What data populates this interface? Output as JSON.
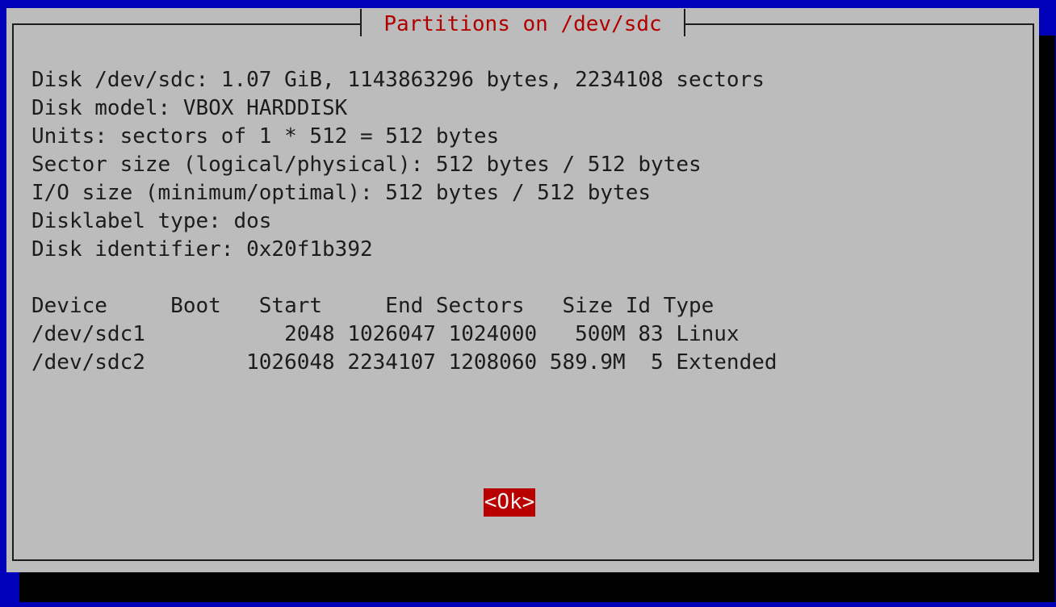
{
  "dialog": {
    "title": "Partitions on /dev/sdc",
    "info_lines": [
      "Disk /dev/sdc: 1.07 GiB, 1143863296 bytes, 2234108 sectors",
      "Disk model: VBOX HARDDISK",
      "Units: sectors of 1 * 512 = 512 bytes",
      "Sector size (logical/physical): 512 bytes / 512 bytes",
      "I/O size (minimum/optimal): 512 bytes / 512 bytes",
      "Disklabel type: dos",
      "Disk identifier: 0x20f1b392"
    ],
    "table": {
      "header": "Device     Boot   Start     End Sectors   Size Id Type",
      "rows": [
        "/dev/sdc1           2048 1026047 1024000   500M 83 Linux",
        "/dev/sdc2        1026048 2234107 1208060 589.9M  5 Extended"
      ]
    },
    "ok_label": "<Ok>"
  },
  "colors": {
    "background": "#0000b8",
    "dialog": "#bcbcbc",
    "title": "#b00000",
    "button": "#b80000"
  }
}
